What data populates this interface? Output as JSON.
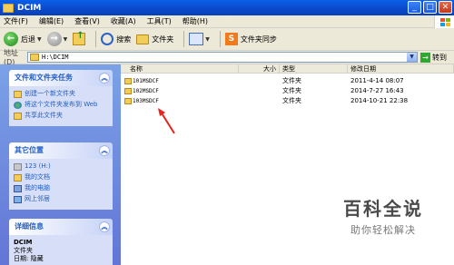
{
  "window": {
    "title": "DCIM"
  },
  "menu": [
    "文件(F)",
    "编辑(E)",
    "查看(V)",
    "收藏(A)",
    "工具(T)",
    "帮助(H)"
  ],
  "toolbar": {
    "back_label": "后退",
    "search_label": "搜索",
    "folders_label": "文件夹",
    "sync_label": "文件夹同步"
  },
  "address": {
    "label": "地址(D)",
    "value": "H:\\DCIM",
    "go_label": "转到"
  },
  "tasks_panel": {
    "title": "文件和文件夹任务",
    "items": [
      "创建一个新文件夹",
      "将这个文件夹发布到 Web",
      "共享此文件夹"
    ]
  },
  "places_panel": {
    "title": "其它位置",
    "items": [
      "123 (H:)",
      "我的文档",
      "我的电脑",
      "网上邻居"
    ]
  },
  "details_panel": {
    "title": "详细信息",
    "name": "DCIM",
    "type": "文件夹",
    "date_label": "日期: 隐藏"
  },
  "columns": {
    "name": "名称",
    "size": "大小",
    "type": "类型",
    "modified": "修改日期"
  },
  "files": [
    {
      "name": "101MSDCF",
      "type": "文件夹",
      "modified": "2011-4-14 08:07"
    },
    {
      "name": "102MSDCF",
      "type": "文件夹",
      "modified": "2014-7-27 16:43"
    },
    {
      "name": "103MSDCF",
      "type": "文件夹",
      "modified": "2014-10-21 22:38"
    }
  ],
  "watermark": {
    "title": "百科全说",
    "subtitle": "助你轻松解决"
  },
  "colors": {
    "titlebar": "#0a49c9",
    "task_pane": "#7ba2e7",
    "arrow": "#e8231c"
  }
}
